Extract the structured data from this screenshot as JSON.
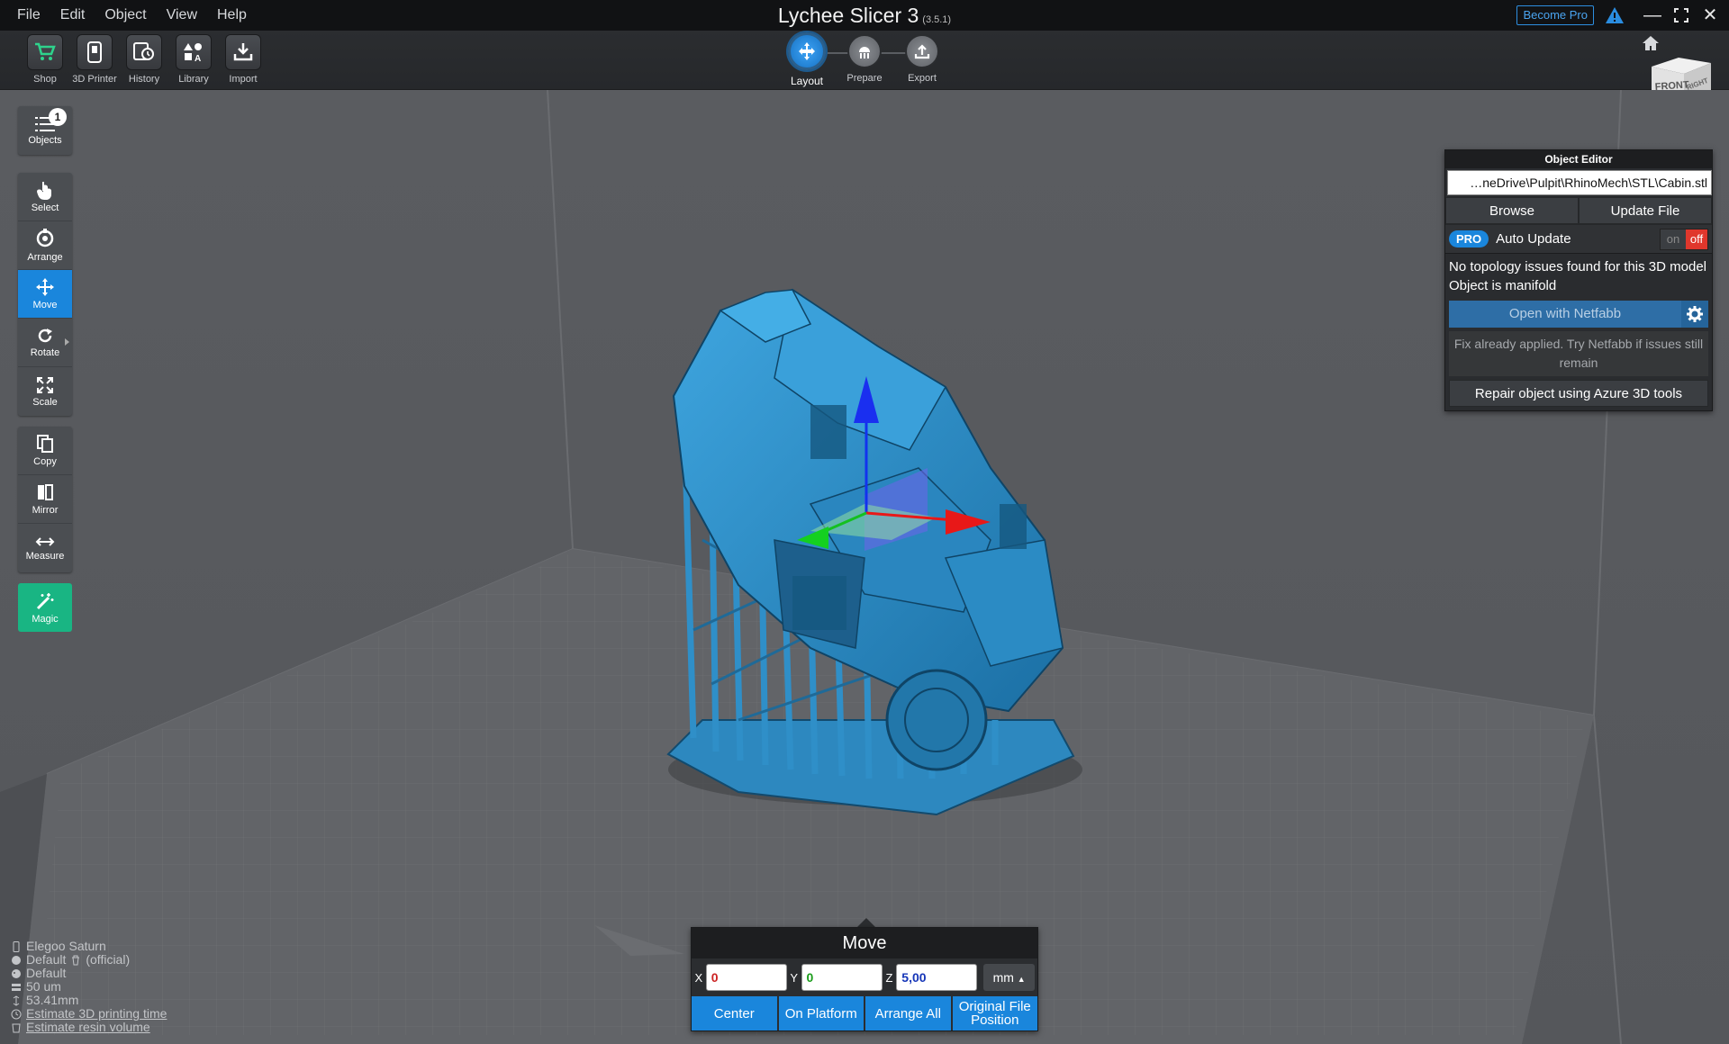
{
  "menu": [
    "File",
    "Edit",
    "Object",
    "View",
    "Help"
  ],
  "app": {
    "title": "Lychee Slicer 3",
    "version": "(3.5.1)",
    "become_pro": "Become Pro"
  },
  "toolbar": {
    "items": [
      {
        "label": "Shop",
        "icon": "cart-icon"
      },
      {
        "label": "3D Printer",
        "icon": "printer-icon"
      },
      {
        "label": "History",
        "icon": "history-icon"
      },
      {
        "label": "Library",
        "icon": "library-icon"
      },
      {
        "label": "Import",
        "icon": "import-icon"
      }
    ]
  },
  "stepper": {
    "layout": "Layout",
    "prepare": "Prepare",
    "export": "Export"
  },
  "view_cube": {
    "front": "FRONT",
    "right": "RIGHT"
  },
  "sidebar": {
    "objects": {
      "label": "Objects",
      "count": "1"
    },
    "select": "Select",
    "arrange": "Arrange",
    "move": "Move",
    "rotate": "Rotate",
    "scale": "Scale",
    "copy": "Copy",
    "mirror": "Mirror",
    "measure": "Measure",
    "magic": "Magic"
  },
  "object_editor": {
    "title": "Object Editor",
    "path": "…neDrive\\Pulpit\\RhinoMech\\STL\\Cabin.stl",
    "browse": "Browse",
    "update": "Update File",
    "pro": "PRO",
    "auto_update": "Auto Update",
    "toggle_on": "on",
    "toggle_off": "off",
    "topology_line1": "No topology issues found for this 3D model",
    "topology_line2": "Object is manifold",
    "netfabb": "Open with Netfabb",
    "fix_msg": "Fix already applied. Try Netfabb if issues still remain",
    "azure": "Repair object using Azure 3D tools"
  },
  "move_panel": {
    "title": "Move",
    "x_label": "X",
    "y_label": "Y",
    "z_label": "Z",
    "x": "0",
    "y": "0",
    "z": "5,00",
    "unit": "mm",
    "center": "Center",
    "on_platform": "On Platform",
    "arrange_all": "Arrange All",
    "original_line1": "Original File",
    "original_line2": "Position"
  },
  "printer_info": {
    "printer": "Elegoo Saturn",
    "resin": "Default",
    "resin_suffix": "(official)",
    "profile": "Default",
    "layer": "50 um",
    "height": "53.41mm",
    "estimate_time": "Estimate 3D printing time",
    "estimate_volume": "Estimate resin volume"
  },
  "colors": {
    "accent": "#1a86dc",
    "magic": "#19b583",
    "model": "#2f8fc8",
    "background": "#5b5e62"
  }
}
